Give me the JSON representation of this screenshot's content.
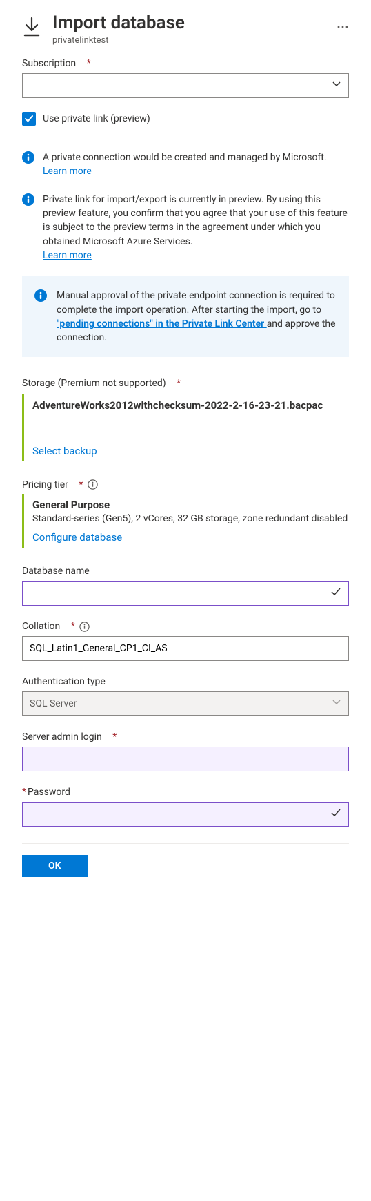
{
  "header": {
    "title": "Import database",
    "subtitle": "privatelinktest"
  },
  "subscription": {
    "label": "Subscription",
    "value": ""
  },
  "usePrivateLink": {
    "label": "Use private link (preview)",
    "checked": true
  },
  "info1": {
    "text": "A private connection would be created and managed by Microsoft.",
    "linkText": "Learn more"
  },
  "info2": {
    "text": "Private link for import/export is currently in preview. By using this preview feature, you confirm that you agree that your use of this feature is subject to the preview terms in the agreement under which you obtained Microsoft Azure Services.",
    "linkText": "Learn more"
  },
  "callout": {
    "textBefore": "Manual approval of the private endpoint connection is required to complete the import operation. After starting the import, go to ",
    "linkText": "\"pending connections\" in the Private Link Center ",
    "textAfter": "and approve the connection."
  },
  "storage": {
    "label": "Storage (Premium not supported)",
    "value": "AdventureWorks2012withchecksum-2022-2-16-23-21.bacpac",
    "actionLabel": "Select backup"
  },
  "pricingTier": {
    "label": "Pricing tier",
    "title": "General Purpose",
    "description": "Standard-series (Gen5), 2 vCores, 32 GB storage, zone redundant disabled",
    "actionLabel": "Configure database"
  },
  "databaseName": {
    "label": "Database name",
    "value": ""
  },
  "collation": {
    "label": "Collation",
    "value": "SQL_Latin1_General_CP1_CI_AS"
  },
  "authType": {
    "label": "Authentication type",
    "value": "SQL Server"
  },
  "adminLogin": {
    "label": "Server admin login",
    "value": ""
  },
  "password": {
    "label": "Password",
    "value": ""
  },
  "footer": {
    "okLabel": "OK"
  }
}
